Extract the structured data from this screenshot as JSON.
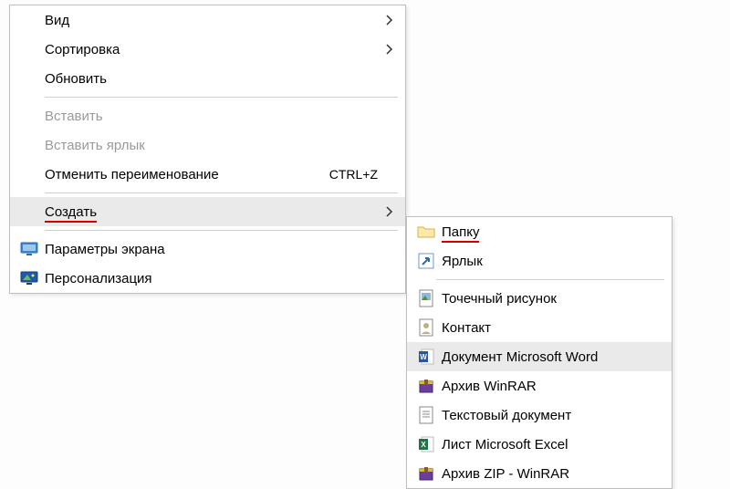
{
  "primary": {
    "view": "Вид",
    "sort": "Сортировка",
    "refresh": "Обновить",
    "paste": "Вставить",
    "paste_shortcut": "Вставить ярлык",
    "undo_rename": "Отменить переименование",
    "undo_shortcut": "CTRL+Z",
    "create": "Создать",
    "display_settings": "Параметры экрана",
    "personalize": "Персонализация"
  },
  "secondary": {
    "folder": "Папку",
    "shortcut": "Ярлык",
    "bitmap": "Точечный рисунок",
    "contact": "Контакт",
    "word_doc": "Документ Microsoft Word",
    "winrar": "Архив WinRAR",
    "text_doc": "Текстовый документ",
    "excel_sheet": "Лист Microsoft Excel",
    "winrar_zip": "Архив ZIP - WinRAR"
  }
}
